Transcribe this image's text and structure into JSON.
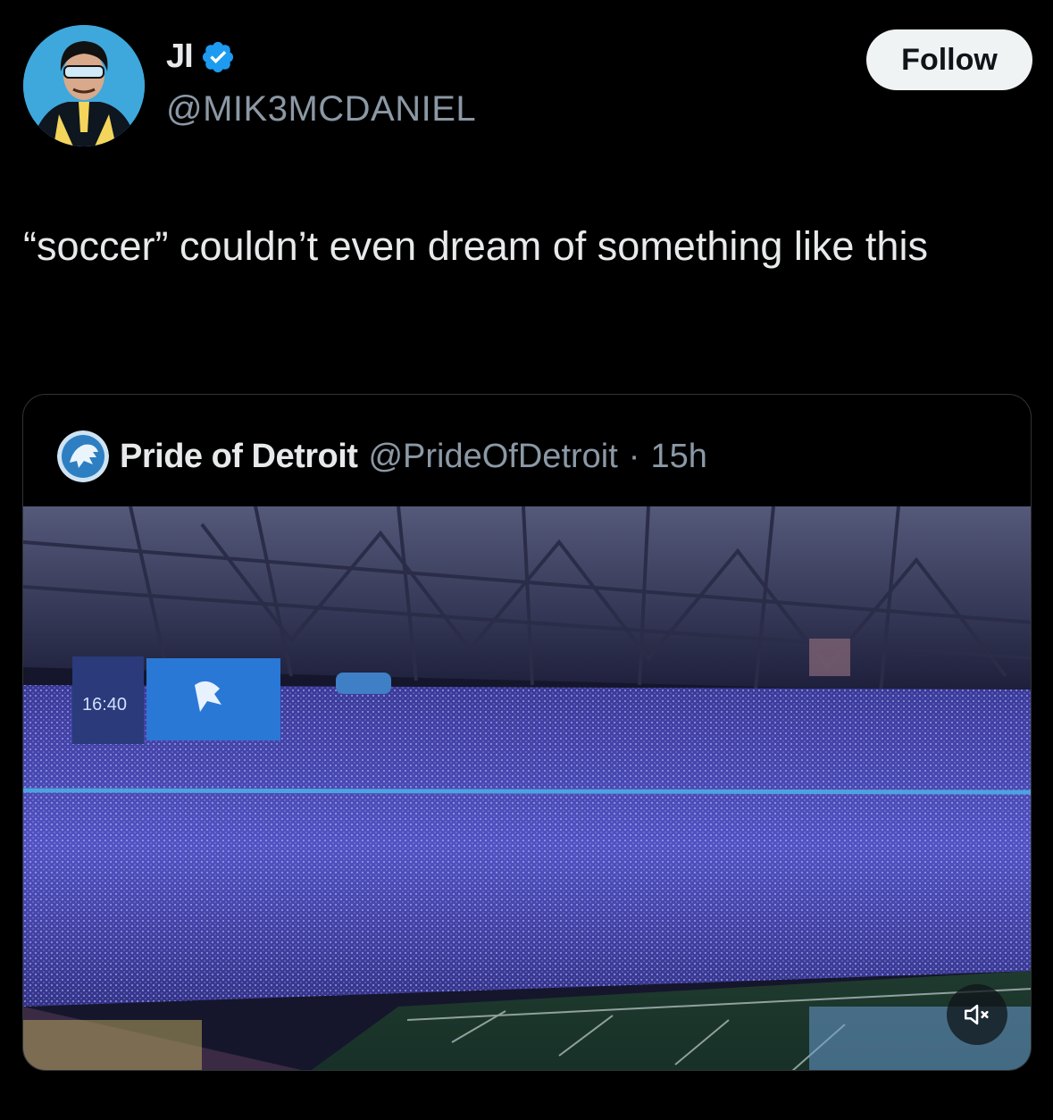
{
  "author": {
    "display_name": "JI",
    "handle": "@MIK3MCDANIEL",
    "verified": true,
    "avatar_icon": "comic-character-avatar"
  },
  "follow_button": {
    "label": "Follow"
  },
  "tweet": {
    "text": "“soccer” couldn’t even dream of something like this"
  },
  "quoted_tweet": {
    "display_name": "Pride of Detroit",
    "handle": "@PrideOfDetroit",
    "separator": "·",
    "time": "15h",
    "avatar_icon": "lion-logo-avatar",
    "media": {
      "type": "video",
      "scoreboard_text": "16:40",
      "muted": true,
      "mute_icon": "speaker-muted-icon"
    }
  },
  "colors": {
    "background": "#000000",
    "text_primary": "#e7e9ea",
    "text_secondary": "#8b98a5",
    "verified": "#1d9bf0",
    "follow_bg": "#eff3f4",
    "card_border": "#2f3336"
  }
}
